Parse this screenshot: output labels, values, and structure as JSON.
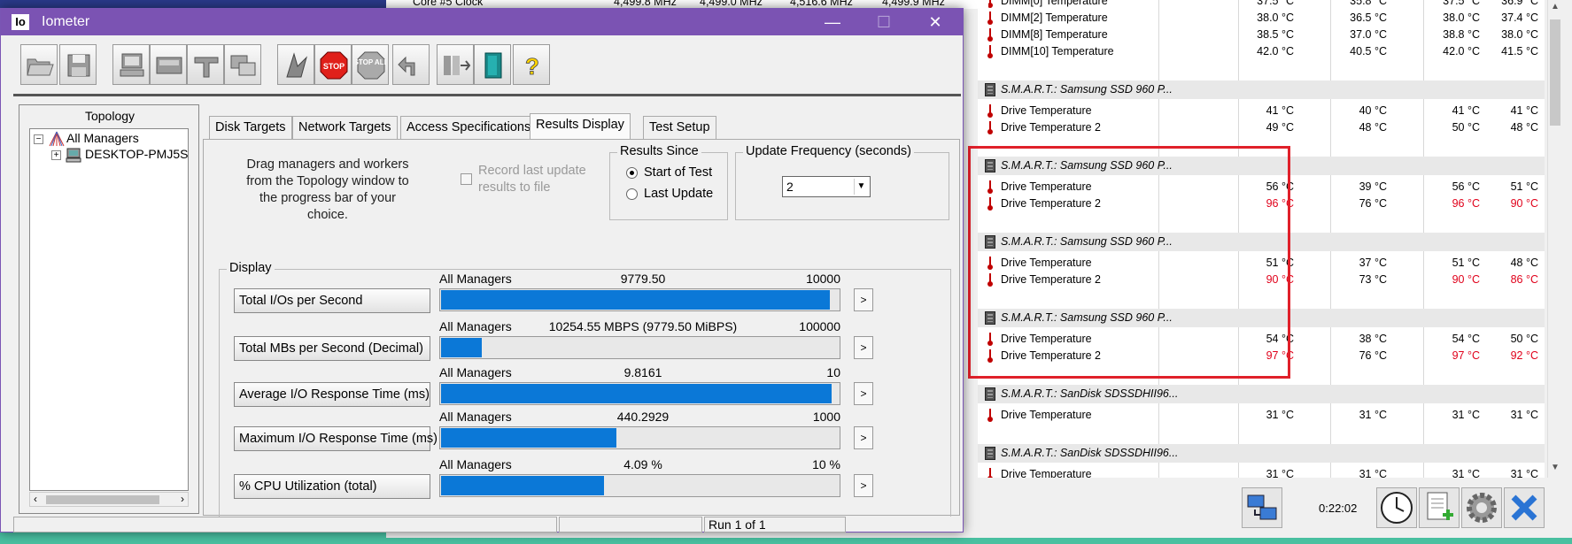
{
  "colors": {
    "iometer_title": "#7b53b3",
    "bar": "#0b78d7",
    "alert_red": "#e0001a",
    "highlight": "#e0202a"
  },
  "bg_window": {
    "top_row": {
      "label": "Core #5 Clock",
      "v1": "4,499.8 MHz",
      "v2": "4,499.0 MHz",
      "v3": "4,516.6 MHz",
      "v4": "4,499.9 MHz"
    },
    "rows": [
      {
        "kind": "sensor",
        "name": "DIMM[0] Temperature",
        "v": [
          "37.5 °C",
          "35.8 °C",
          "37.5 °C",
          "36.9 °C"
        ],
        "red": [
          false,
          false,
          false,
          false
        ],
        "icon": "thermometer-icon"
      },
      {
        "kind": "sensor",
        "name": "DIMM[2] Temperature",
        "v": [
          "38.0 °C",
          "36.5 °C",
          "38.0 °C",
          "37.4 °C"
        ],
        "red": [
          false,
          false,
          false,
          false
        ],
        "icon": "thermometer-icon"
      },
      {
        "kind": "sensor",
        "name": "DIMM[8] Temperature",
        "v": [
          "38.5 °C",
          "37.0 °C",
          "38.8 °C",
          "38.0 °C"
        ],
        "red": [
          false,
          false,
          false,
          false
        ],
        "icon": "thermometer-icon"
      },
      {
        "kind": "sensor",
        "name": "DIMM[10] Temperature",
        "v": [
          "42.0 °C",
          "40.5 °C",
          "42.0 °C",
          "41.5 °C"
        ],
        "red": [
          false,
          false,
          false,
          false
        ],
        "icon": "thermometer-icon"
      },
      {
        "kind": "blank"
      },
      {
        "kind": "header",
        "name": "S.M.A.R.T.: Samsung SSD 960 P...",
        "icon": "drive-chip-icon"
      },
      {
        "kind": "sensor",
        "name": "Drive Temperature",
        "v": [
          "41 °C",
          "40 °C",
          "41 °C",
          "41 °C"
        ],
        "red": [
          false,
          false,
          false,
          false
        ],
        "icon": "thermometer-icon"
      },
      {
        "kind": "sensor",
        "name": "Drive Temperature 2",
        "v": [
          "49 °C",
          "48 °C",
          "50 °C",
          "48 °C"
        ],
        "red": [
          false,
          false,
          false,
          false
        ],
        "icon": "thermometer-icon"
      },
      {
        "kind": "blank"
      },
      {
        "kind": "header",
        "name": "S.M.A.R.T.: Samsung SSD 960 P...",
        "icon": "drive-chip-icon"
      },
      {
        "kind": "sensor",
        "name": "Drive Temperature",
        "v": [
          "56 °C",
          "39 °C",
          "56 °C",
          "51 °C"
        ],
        "red": [
          false,
          false,
          false,
          false
        ],
        "icon": "thermometer-icon"
      },
      {
        "kind": "sensor",
        "name": "Drive Temperature 2",
        "v": [
          "96 °C",
          "76 °C",
          "96 °C",
          "90 °C"
        ],
        "red": [
          true,
          false,
          true,
          true
        ],
        "icon": "thermometer-icon"
      },
      {
        "kind": "blank"
      },
      {
        "kind": "header",
        "name": "S.M.A.R.T.: Samsung SSD 960 P...",
        "icon": "drive-chip-icon"
      },
      {
        "kind": "sensor",
        "name": "Drive Temperature",
        "v": [
          "51 °C",
          "37 °C",
          "51 °C",
          "48 °C"
        ],
        "red": [
          false,
          false,
          false,
          false
        ],
        "icon": "thermometer-icon"
      },
      {
        "kind": "sensor",
        "name": "Drive Temperature 2",
        "v": [
          "90 °C",
          "73 °C",
          "90 °C",
          "86 °C"
        ],
        "red": [
          true,
          false,
          true,
          true
        ],
        "icon": "thermometer-icon"
      },
      {
        "kind": "blank"
      },
      {
        "kind": "header",
        "name": "S.M.A.R.T.: Samsung SSD 960 P...",
        "icon": "drive-chip-icon"
      },
      {
        "kind": "sensor",
        "name": "Drive Temperature",
        "v": [
          "54 °C",
          "38 °C",
          "54 °C",
          "50 °C"
        ],
        "red": [
          false,
          false,
          false,
          false
        ],
        "icon": "thermometer-icon"
      },
      {
        "kind": "sensor",
        "name": "Drive Temperature 2",
        "v": [
          "97 °C",
          "76 °C",
          "97 °C",
          "92 °C"
        ],
        "red": [
          true,
          false,
          true,
          true
        ],
        "icon": "thermometer-icon"
      },
      {
        "kind": "blank"
      },
      {
        "kind": "header",
        "name": "S.M.A.R.T.: SanDisk SDSSDHII96...",
        "icon": "drive-chip-icon"
      },
      {
        "kind": "sensor",
        "name": "Drive Temperature",
        "v": [
          "31 °C",
          "31 °C",
          "31 °C",
          "31 °C"
        ],
        "red": [
          false,
          false,
          false,
          false
        ],
        "icon": "thermometer-icon"
      },
      {
        "kind": "blank"
      },
      {
        "kind": "header",
        "name": "S.M.A.R.T.: SanDisk SDSSDHII96...",
        "icon": "drive-chip-icon"
      },
      {
        "kind": "sensor",
        "name": "Drive Temperature",
        "v": [
          "31 °C",
          "31 °C",
          "31 °C",
          "31 °C"
        ],
        "red": [
          false,
          false,
          false,
          false
        ],
        "icon": "thermometer-icon"
      }
    ],
    "timer": "0:22:02",
    "toolbar_icons": [
      "network-monitor-icon",
      "clock-icon",
      "report-add-icon",
      "settings-gear-icon",
      "close-x-icon"
    ]
  },
  "iometer": {
    "title": "Iometer",
    "logo_text": "Io",
    "window_buttons": {
      "minimize": "—",
      "maximize": "☐",
      "close": "✕"
    },
    "toolbar_icons": [
      "open-config-icon",
      "save-config-icon",
      "start-worker-icon",
      "start-disk-worker-icon",
      "start-network-worker-icon",
      "duplicate-worker-icon",
      "start-test-icon",
      "stop-icon",
      "stop-all-icon",
      "reset-icon",
      "exit-manager-icon",
      "exit-icon",
      "help-icon"
    ],
    "stop_label": "STOP",
    "stop_all_label": "STOP ALL",
    "help_label": "?",
    "topology": {
      "title": "Topology",
      "root": "All Managers",
      "child": "DESKTOP-PMJ5S",
      "root_toggle": "−",
      "child_toggle": "+"
    },
    "tabs": [
      "Disk Targets",
      "Network Targets",
      "Access Specifications",
      "Results Display",
      "Test Setup"
    ],
    "active_tab": "Results Display",
    "drag_text": "Drag managers and workers from the Topology window to the progress bar of your choice.",
    "record_label": "Record last update results to file",
    "results_since": {
      "label": "Results Since",
      "options": [
        "Start of Test",
        "Last Update"
      ],
      "selected": "Start of Test"
    },
    "update_frequency": {
      "label": "Update Frequency (seconds)",
      "value": "2"
    },
    "display_label": "Display",
    "metrics": [
      {
        "button": "Total I/Os per Second",
        "source": "All Managers",
        "value": "9779.50",
        "max": "10000",
        "fraction": 0.978
      },
      {
        "button": "Total MBs per Second (Decimal)",
        "source": "All Managers",
        "value": "10254.55 MBPS (9779.50 MiBPS)",
        "max": "100000",
        "fraction": 0.1025
      },
      {
        "button": "Average I/O Response Time (ms)",
        "source": "All Managers",
        "value": "9.8161",
        "max": "10",
        "fraction": 0.982
      },
      {
        "button": "Maximum I/O Response Time (ms)",
        "source": "All Managers",
        "value": "440.2929",
        "max": "1000",
        "fraction": 0.44
      },
      {
        "button": "% CPU Utilization (total)",
        "source": "All Managers",
        "value": "4.09 %",
        "max": "10 %",
        "fraction": 0.409
      }
    ],
    "arrow": ">",
    "status": "Run 1 of 1"
  }
}
